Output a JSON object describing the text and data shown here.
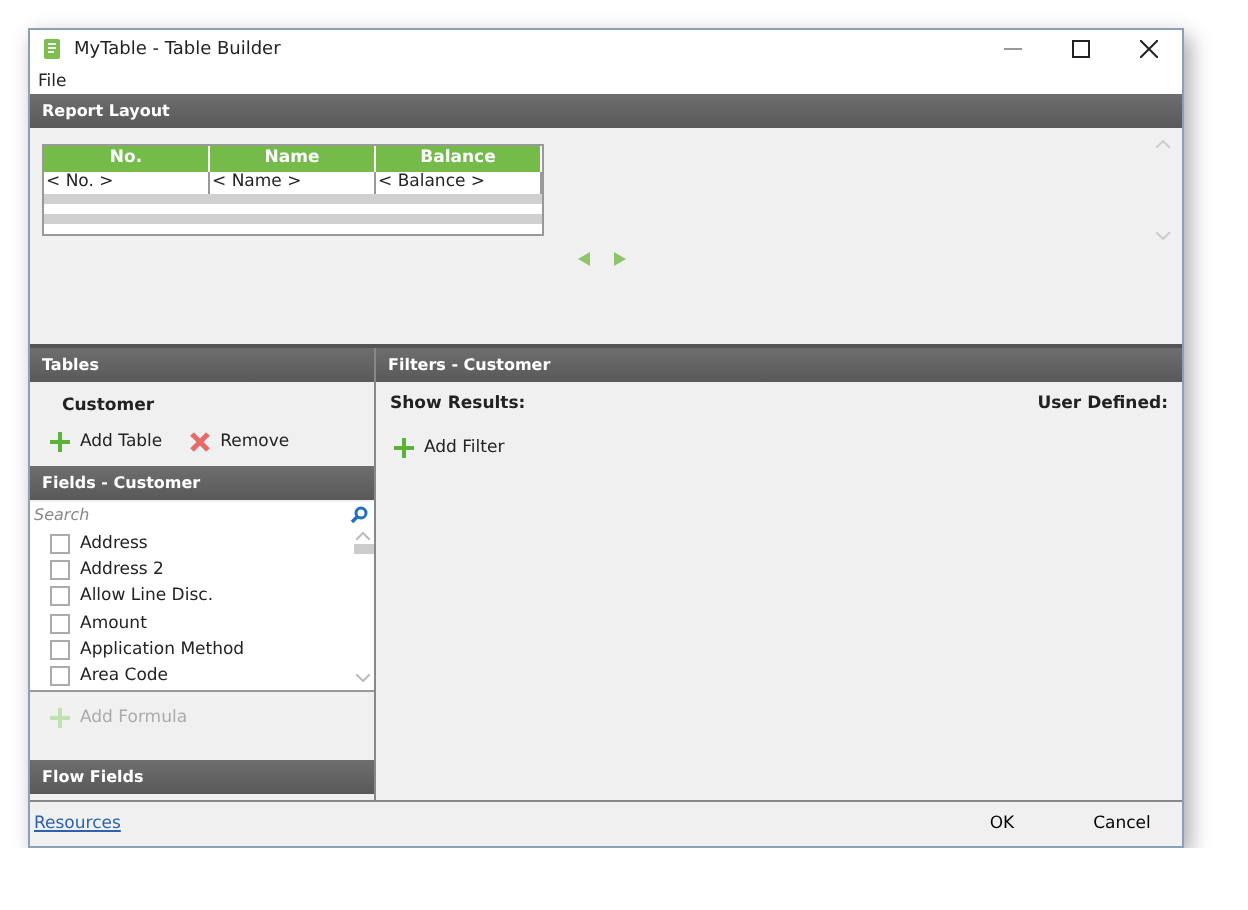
{
  "window": {
    "title": "MyTable - Table Builder"
  },
  "menu": [
    "File"
  ],
  "report_layout": {
    "title": "Report Layout",
    "columns": [
      "No.",
      "Name",
      "Balance"
    ],
    "row": [
      "< No. >",
      "< Name >",
      "< Balance >"
    ]
  },
  "tables": {
    "title": "Tables",
    "name": "Customer",
    "actions": [
      {
        "kind": "add",
        "label": "Add Table"
      },
      {
        "kind": "remove",
        "label": "Remove"
      }
    ]
  },
  "fields": {
    "title": "Fields - Customer",
    "placeholder": "Search",
    "items": [
      {
        "label": "Address",
        "checked": false
      },
      {
        "label": "Address 2",
        "checked": false
      },
      {
        "label": "Allow Line Disc.",
        "checked": false
      },
      {
        "label": "Amount",
        "checked": false
      },
      {
        "label": "Application Method",
        "checked": false
      },
      {
        "label": "Area Code",
        "checked": false
      }
    ],
    "add_formula": {
      "label": "Add Formula",
      "disabled": true
    }
  },
  "flow_fields": {
    "title": "Flow Fields"
  },
  "filters": {
    "title": "Filters - Customer",
    "show_results": "Show Results:",
    "user_defined": "User Defined:",
    "add": "Add Filter"
  },
  "footer": {
    "link": "Resources",
    "buttons": [
      "OK",
      "Cancel"
    ]
  }
}
